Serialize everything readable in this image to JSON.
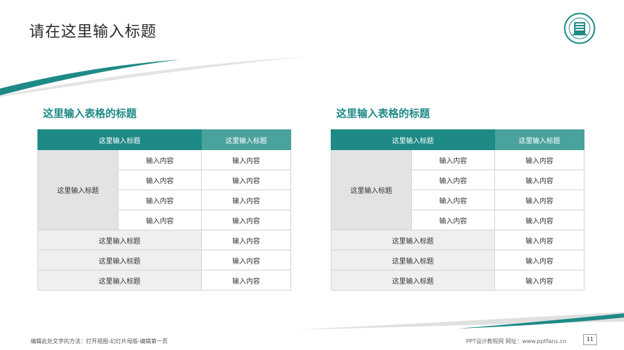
{
  "header": {
    "title": "请在这里输入标题"
  },
  "colors": {
    "accent": "#1e8a86",
    "accent_light": "#4aa29d",
    "gray_cell": "#e3e3e3"
  },
  "tables": [
    {
      "title": "这里输入表格的标题",
      "header": [
        "这里输入标题",
        "这里输入标题"
      ],
      "group_label": "这里输入标题",
      "group_rows": [
        [
          "输入内容",
          "输入内容"
        ],
        [
          "输入内容",
          "输入内容"
        ],
        [
          "输入内容",
          "输入内容"
        ],
        [
          "输入内容",
          "输入内容"
        ]
      ],
      "rows": [
        [
          "这里输入标题",
          "输入内容"
        ],
        [
          "这里输入标题",
          "输入内容"
        ],
        [
          "这里输入标题",
          "输入内容"
        ]
      ]
    },
    {
      "title": "这里输入表格的标题",
      "header": [
        "这里输入标题",
        "这里输入标题"
      ],
      "group_label": "这里输入标题",
      "group_rows": [
        [
          "输入内容",
          "输入内容"
        ],
        [
          "输入内容",
          "输入内容"
        ],
        [
          "输入内容",
          "输入内容"
        ],
        [
          "输入内容",
          "输入内容"
        ]
      ],
      "rows": [
        [
          "这里输入标题",
          "输入内容"
        ],
        [
          "这里输入标题",
          "输入内容"
        ],
        [
          "这里输入标题",
          "输入内容"
        ]
      ]
    }
  ],
  "footer": {
    "hint": "编辑此处文字的方法：打开视图-幻灯片母版-编辑第一页",
    "site": "PPT设计教程网   网址：www.pptfans.cn",
    "page": "11"
  }
}
